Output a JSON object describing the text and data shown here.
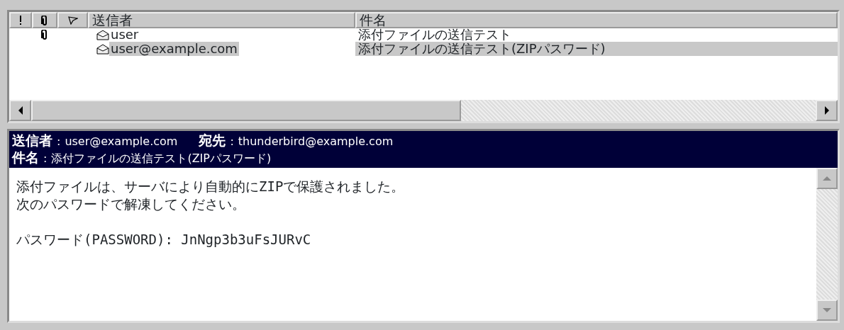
{
  "message_list": {
    "columns": [
      {
        "kind": "priority"
      },
      {
        "kind": "attachment"
      },
      {
        "kind": "flag"
      },
      {
        "kind": "text",
        "label": "送信者"
      },
      {
        "kind": "text",
        "label": "件名"
      }
    ],
    "rows": [
      {
        "attachment": true,
        "sender": "user",
        "subject": "添付ファイルの送信テスト",
        "selected": false
      },
      {
        "attachment": false,
        "sender": "user@example.com",
        "subject": "添付ファイルの送信テスト(ZIPパスワード)",
        "selected": true
      }
    ]
  },
  "message_header": {
    "from_label": "送信者",
    "from_separator": ":",
    "from": "user@example.com",
    "to_label": "宛先",
    "to_separator": ":",
    "to": "thunderbird@example.com",
    "subject_label": "件名",
    "subject_separator": ":",
    "subject": "添付ファイルの送信テスト(ZIPパスワード)"
  },
  "message_body": [
    {
      "lines": [
        "添付ファイルは、サーバにより自動的にZIPで保護されました。",
        "次のパスワードで解凍してください。"
      ]
    },
    {
      "lines": [
        "パスワード(PASSWORD): JnNgp3b3uFsJURvC"
      ]
    }
  ]
}
